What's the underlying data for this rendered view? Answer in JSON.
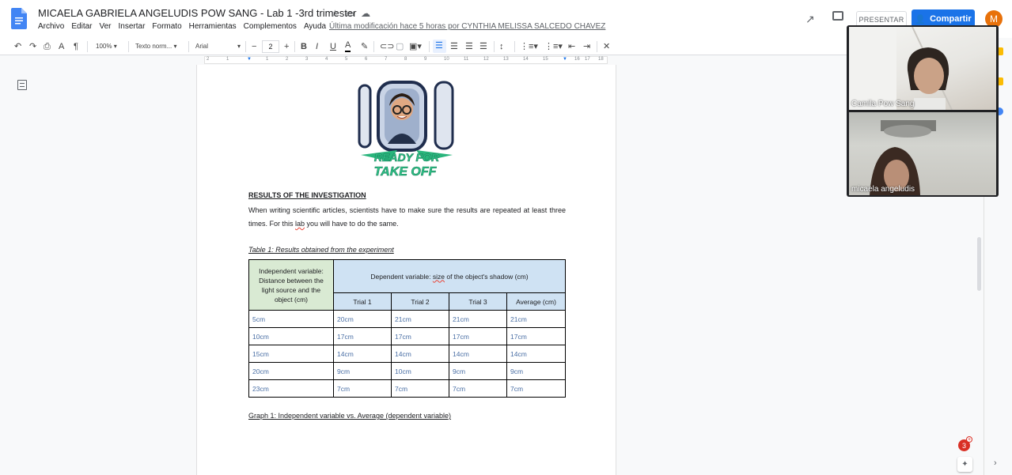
{
  "document": {
    "title": "MICAELA GABRIELA ANGELUDIS POW SANG - Lab 1 -3rd trimester",
    "last_edit": "Última modificación hace 5 horas por CYNTHIA MELISSA SALCEDO CHAVEZ"
  },
  "menu": [
    "Archivo",
    "Editar",
    "Ver",
    "Insertar",
    "Formato",
    "Herramientas",
    "Complementos",
    "Ayuda"
  ],
  "header_actions": {
    "present_label": "PRESENTAR",
    "share_label": "Compartir",
    "avatar_initial": "M",
    "accent_color": "#1a73e8",
    "avatar_color": "#e8710a"
  },
  "toolbar": {
    "zoom": "100%",
    "style": "Texto norm...",
    "font": "Arial",
    "font_size": "2",
    "bold": "B",
    "italic": "I",
    "underline": "U",
    "text_color": "A"
  },
  "ruler_ticks": [
    "2",
    "1",
    "1",
    "2",
    "3",
    "4",
    "5",
    "6",
    "7",
    "8",
    "9",
    "10",
    "11",
    "12",
    "13",
    "14",
    "15",
    "16",
    "17",
    "18"
  ],
  "sticker": {
    "text_line1": "READY FOR",
    "text_line2": "TAKE OFF"
  },
  "content": {
    "results_heading": "RESULTS OF THE INVESTIGATION",
    "para_part1": "When writing scientific articles, scientists have to make sure the results are repeated at least three times. For this ",
    "para_lab": "lab",
    "para_part2": " you will have to do the same.",
    "table_caption": "Table 1: Results obtained from the experiment",
    "graph_caption": "Graph 1: Independent variable vs. Average (dependent variable)"
  },
  "table": {
    "iv_header": "Independent variable: Distance between the light source and the object (cm)",
    "dv_header_pre": "Dependent variable: ",
    "dv_header_size": "size",
    "dv_header_post": " of the object's shadow (cm)",
    "columns": [
      "Trial 1",
      "Trial 2",
      "Trial 3",
      "Average (cm)"
    ],
    "rows": [
      [
        "5cm",
        "20cm",
        "21cm",
        "21cm",
        "21cm"
      ],
      [
        "10cm",
        "17cm",
        "17cm",
        "17cm",
        "17cm"
      ],
      [
        "15cm",
        "14cm",
        "14cm",
        "14cm",
        "14cm"
      ],
      [
        "20cm",
        "9cm",
        "10cm",
        "9cm",
        "9cm"
      ],
      [
        "23cm",
        "7cm",
        "7cm",
        "7cm",
        "7cm"
      ]
    ],
    "iv_color": "#d9ead3",
    "dv_color": "#cfe2f3"
  },
  "participants": [
    {
      "name": "Camila Pow Sang"
    },
    {
      "name": "micaela angeludis"
    }
  ],
  "notifications": {
    "count": "3"
  }
}
